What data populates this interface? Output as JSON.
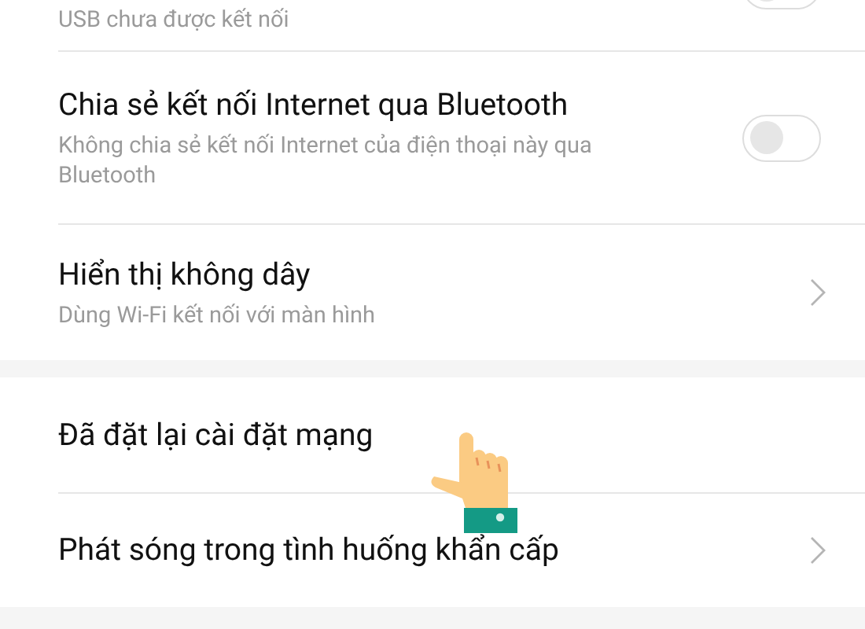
{
  "sections": [
    {
      "items": [
        {
          "kind": "toggle",
          "subtitle": "USB chưa được kết nối",
          "on": false
        },
        {
          "kind": "toggle",
          "title": "Chia sẻ kết nối Internet qua Bluetooth",
          "subtitle": "Không chia sẻ kết nối Internet của điện thoại này qua Bluetooth",
          "on": false
        },
        {
          "kind": "link",
          "title": "Hiển thị không dây",
          "subtitle": "Dùng Wi-Fi kết nối với màn hình"
        }
      ]
    },
    {
      "items": [
        {
          "kind": "plain",
          "title": "Đã đặt lại cài đặt mạng"
        },
        {
          "kind": "link",
          "title": "Phát sóng trong tình huống khẩn cấp"
        }
      ]
    }
  ]
}
